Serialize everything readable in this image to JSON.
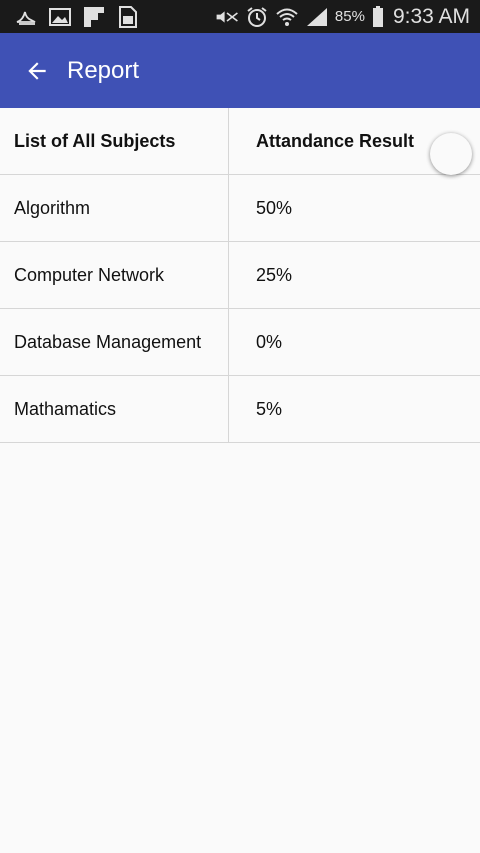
{
  "status_bar": {
    "battery_percent": "85%",
    "time": "9:33 AM",
    "icons": [
      "notification-icon",
      "gallery-icon",
      "flipboard-icon",
      "sim-icon",
      "mute-icon",
      "alarm-icon",
      "wifi-icon",
      "signal-icon",
      "battery-icon"
    ]
  },
  "app_bar": {
    "title": "Report",
    "back_icon": "arrow-left-icon"
  },
  "table": {
    "headers": [
      "List of All Subjects",
      "Attandance Result"
    ],
    "rows": [
      [
        "Algorithm",
        "50%"
      ],
      [
        "Computer Network",
        "25%"
      ],
      [
        "Database Management",
        "0%"
      ],
      [
        "Mathamatics",
        "5%"
      ]
    ]
  },
  "colors": {
    "primary": "#3f51b5",
    "status_bar": "#1a1a1a",
    "background": "#fafafa",
    "divider": "#d6d6d6"
  }
}
